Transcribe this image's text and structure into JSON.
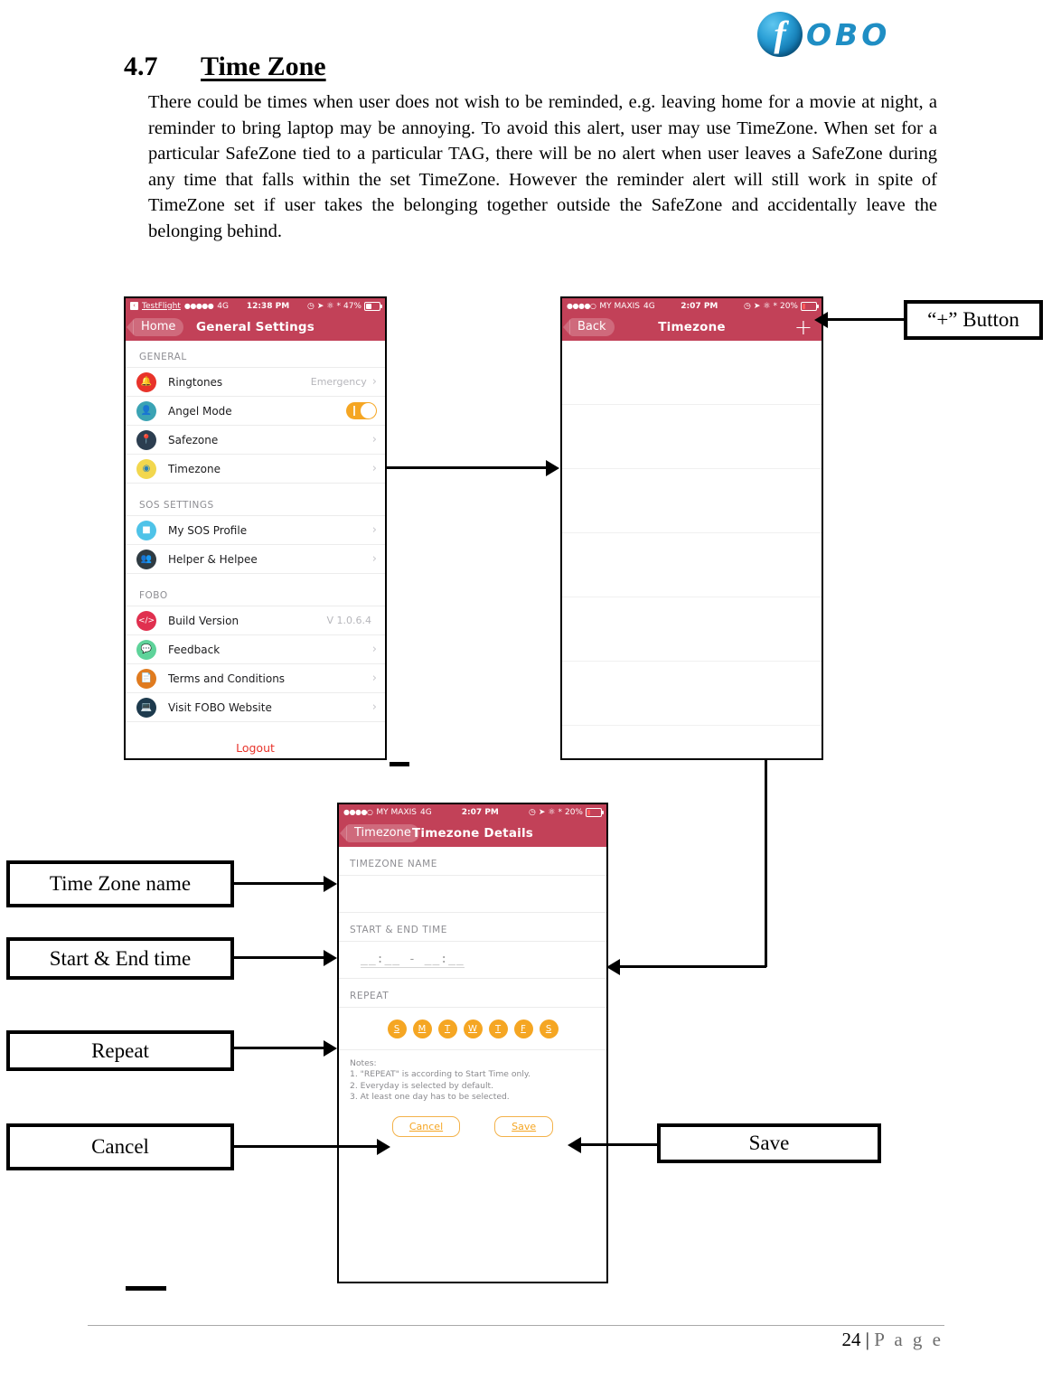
{
  "brand": {
    "logo_text": "OBO",
    "logo_letter": "f"
  },
  "section": {
    "number": "4.7",
    "title": "Time Zone"
  },
  "paragraph": "There could be times when user does not wish to be reminded, e.g. leaving home for a movie at night, a reminder to bring laptop may be annoying. To avoid this alert, user may use TimeZone. When set for a particular SafeZone tied to a particular TAG, there will be no alert when user leaves a SafeZone during any time that falls within the set TimeZone. However the reminder alert will still work in spite of TimeZone set if user takes the belonging together outside the SafeZone and accidentally leave the belonging behind.",
  "screen_settings": {
    "status": {
      "badge": "<",
      "carrier_app": "TestFlight",
      "dots": "●●●●●",
      "network": "4G",
      "time": "12:38 PM",
      "battery": "47%"
    },
    "nav": {
      "back": "Home",
      "title": "General Settings"
    },
    "groups": [
      {
        "header": "GENERAL",
        "rows": [
          {
            "label": "Ringtones",
            "value": "Emergency",
            "accessory": "chevron",
            "icon": "bell-icon",
            "icon_color": "#e8332a"
          },
          {
            "label": "Angel Mode",
            "value": "",
            "accessory": "toggle",
            "icon": "angel-icon",
            "icon_color": "#3aa3b4"
          },
          {
            "label": "Safezone",
            "value": "",
            "accessory": "chevron",
            "icon": "map-pin-icon",
            "icon_color": "#2c3e50"
          },
          {
            "label": "Timezone",
            "value": "",
            "accessory": "chevron",
            "icon": "clock-icon",
            "icon_color": "#f2d74e"
          }
        ]
      },
      {
        "header": "SOS SETTINGS",
        "rows": [
          {
            "label": "My SOS Profile",
            "value": "",
            "accessory": "chevron",
            "icon": "siren-icon",
            "icon_color": "#4fc3e8"
          },
          {
            "label": "Helper & Helpee",
            "value": "",
            "accessory": "chevron",
            "icon": "people-icon",
            "icon_color": "#2f3b42"
          }
        ]
      },
      {
        "header": "FOBO",
        "rows": [
          {
            "label": "Build Version",
            "value": "V 1.0.6.4",
            "accessory": "none",
            "icon": "code-icon",
            "icon_color": "#e0304f"
          },
          {
            "label": "Feedback",
            "value": "",
            "accessory": "chevron",
            "icon": "chat-icon",
            "icon_color": "#5ed39a"
          },
          {
            "label": "Terms and Conditions",
            "value": "",
            "accessory": "chevron",
            "icon": "document-icon",
            "icon_color": "#e07b1f"
          },
          {
            "label": "Visit FOBO Website",
            "value": "",
            "accessory": "chevron",
            "icon": "browser-icon",
            "icon_color": "#1d3a4d"
          }
        ]
      }
    ],
    "logout": "Logout"
  },
  "screen_timezone_list": {
    "status": {
      "dots": "●●●●○",
      "carrier": "MY MAXIS",
      "network": "4G",
      "time": "2:07 PM",
      "battery": "20%"
    },
    "nav": {
      "back": "Back",
      "title": "Timezone",
      "add": "+"
    },
    "empty_row_count": 7
  },
  "screen_timezone_details": {
    "status": {
      "dots": "●●●●○",
      "carrier": "MY MAXIS",
      "network": "4G",
      "time": "2:07 PM",
      "battery": "20%"
    },
    "nav": {
      "back": "Timezone",
      "title": "Timezone Details"
    },
    "name_section": {
      "label": "TIMEZONE NAME",
      "value": ""
    },
    "time_section": {
      "label": "START & END TIME",
      "placeholder": "__:__ - __:__"
    },
    "repeat_section": {
      "label": "REPEAT",
      "days": [
        "S",
        "M",
        "T",
        "W",
        "T",
        "F",
        "S"
      ]
    },
    "notes": {
      "title": "Notes:",
      "items": [
        "1. \"REPEAT\" is according to Start Time only.",
        "2. Everyday is selected by default.",
        "3. At least one day has to be selected."
      ]
    },
    "buttons": {
      "cancel": "Cancel",
      "save": "Save"
    }
  },
  "annotations": {
    "plus_button": "“+” Button",
    "time_zone_name": "Time Zone name",
    "start_end_time": "Start & End time",
    "repeat": "Repeat",
    "cancel": "Cancel",
    "save": "Save"
  },
  "footer": {
    "page_number": "24",
    "separator": " | ",
    "page_word": "P a g e"
  },
  "colors": {
    "nav_red": "#c24158",
    "accent_orange": "#f5a623",
    "logout_red": "#e8332a",
    "brand_blue": "#1f8ec4"
  }
}
